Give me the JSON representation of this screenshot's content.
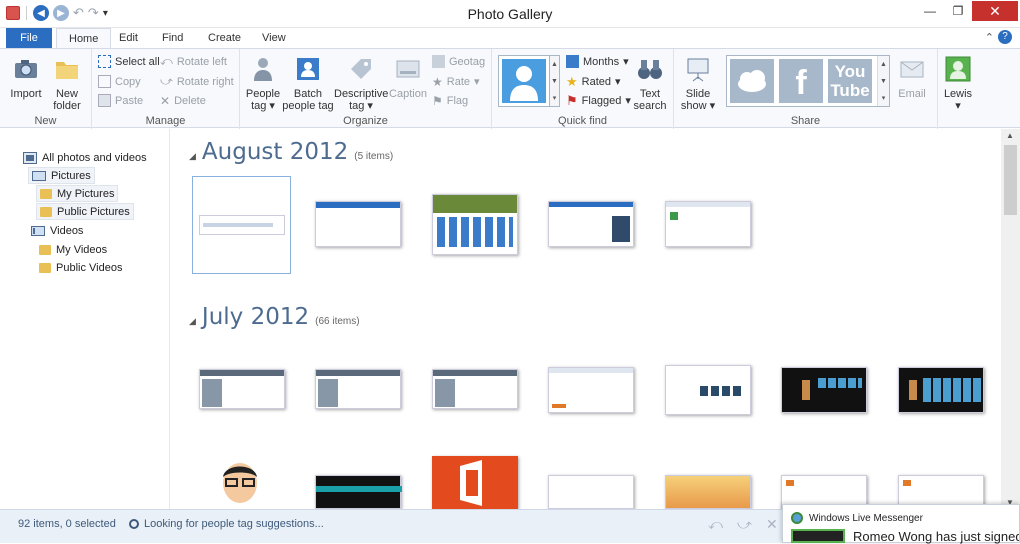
{
  "window": {
    "title": "Photo Gallery",
    "close": "✕",
    "maximize": "❐",
    "minimize": "—"
  },
  "tabs": [
    "File",
    "Home",
    "Edit",
    "Find",
    "Create",
    "View"
  ],
  "ribbon": {
    "new": {
      "label": "New",
      "import": "Import",
      "new_folder_l1": "New",
      "new_folder_l2": "folder"
    },
    "manage": {
      "label": "Manage",
      "select_all": "Select all",
      "copy": "Copy",
      "paste": "Paste",
      "rotate_left": "Rotate left",
      "rotate_right": "Rotate right",
      "delete": "Delete"
    },
    "organize": {
      "label": "Organize",
      "people_l1": "People",
      "people_l2": "tag",
      "batch_l1": "Batch",
      "batch_l2": "people tag",
      "desc_l1": "Descriptive",
      "desc_l2": "tag",
      "caption": "Caption",
      "geotag": "Geotag",
      "rate": "Rate",
      "flag": "Flag"
    },
    "quickfind": {
      "label": "Quick find",
      "months": "Months",
      "rated": "Rated",
      "flagged": "Flagged",
      "text_l1": "Text",
      "text_l2": "search"
    },
    "share": {
      "label": "Share",
      "slide_l1": "Slide",
      "slide_l2": "show",
      "email": "Email",
      "youtube_l1": "You",
      "youtube_l2": "Tube",
      "facebook": "f"
    },
    "user": {
      "name": "Lewis"
    }
  },
  "nav": {
    "all": "All photos and videos",
    "pictures": "Pictures",
    "my_pictures": "My Pictures",
    "public_pictures": "Public Pictures",
    "videos": "Videos",
    "my_videos": "My Videos",
    "public_videos": "Public Videos"
  },
  "groups": [
    {
      "title": "August 2012",
      "count": "(5 items)"
    },
    {
      "title": "July 2012",
      "count": "(66 items)"
    }
  ],
  "status": {
    "items": "92 items, 0 selected",
    "message": "Looking for people tag suggestions..."
  },
  "toast": {
    "app": "Windows Live Messenger",
    "text": "Romeo Wong has just signed"
  },
  "colors": {
    "accent": "#2b6ec1",
    "heading": "#4d6b8f",
    "status_bg": "#eaf0f8"
  }
}
